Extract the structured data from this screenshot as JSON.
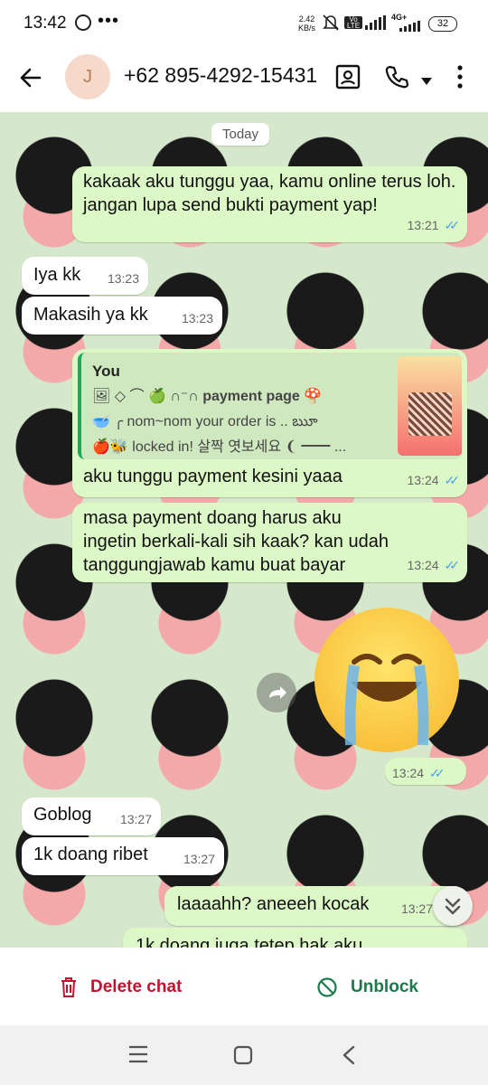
{
  "status_bar": {
    "time": "13:42",
    "more": "•••",
    "speed_value": "2.42",
    "speed_unit": "KB/s",
    "network": "4G+",
    "battery": "32"
  },
  "header": {
    "avatar_initial": "J",
    "title": "+62 895-4292-15431"
  },
  "chat": {
    "date_pill": "Today",
    "messages": [
      {
        "text": "kakaak aku tunggu yaa, kamu online terus loh. jangan lupa send bukti payment yap!",
        "time": "13:21"
      },
      {
        "text": "Iya kk",
        "time": "13:23"
      },
      {
        "text": "Makasih ya kk",
        "time": "13:23"
      },
      {
        "text": "aku tunggu payment kesini yaaa",
        "time": "13:24"
      },
      {
        "text": "masa payment doang harus aku ingetin berkali-kali sih kaak? kan udah tanggungjawab kamu buat bayar",
        "time": "13:24"
      },
      {
        "text": "",
        "time": "13:24"
      },
      {
        "text": "Goblog",
        "time": "13:27"
      },
      {
        "text": "1k doang ribet",
        "time": "13:27"
      },
      {
        "text": "laaaahh? aneeeh kocak",
        "time": "13:27"
      },
      {
        "text": "1k doang juga tetep hak aku",
        "time": ""
      }
    ],
    "quote": {
      "sender": "You",
      "line1": "🖼 ◇ ⌒ 🍏 ∩⁻∩ ",
      "line1_bold": "payment page",
      "line1_end": " 🍄",
      "line2": "🥣 ╭ nom~nom your order is .. ౠ",
      "line3": "🍎🐝 locked in! 살짝 엿보세요 ❨ ━━ ..."
    }
  },
  "actions": {
    "delete_label": "Delete chat",
    "unblock_label": "Unblock"
  },
  "colors": {
    "delete": "#c8102e",
    "unblock": "#1b7a4b",
    "outgoing_bubble": "#dcf8c6",
    "read_ticks": "#4fa3e8"
  }
}
